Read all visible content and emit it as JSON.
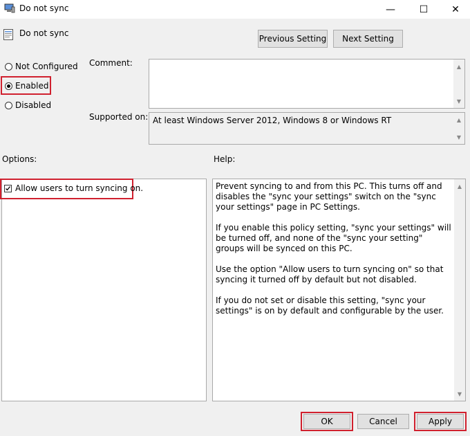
{
  "window": {
    "title": "Do not sync",
    "controls": {
      "minimize": "—",
      "maximize": "☐",
      "close": "✕"
    }
  },
  "policy": {
    "name": "Do not sync"
  },
  "nav": {
    "previous_label": "Previous Setting",
    "next_label": "Next Setting"
  },
  "state": {
    "options": [
      {
        "label": "Not Configured",
        "selected": false
      },
      {
        "label": "Enabled",
        "selected": true
      },
      {
        "label": "Disabled",
        "selected": false
      }
    ]
  },
  "comment": {
    "label": "Comment:",
    "value": ""
  },
  "supported": {
    "label": "Supported on:",
    "value": "At least Windows Server 2012, Windows 8 or Windows RT"
  },
  "options_panel": {
    "label": "Options:",
    "checkbox_label": "Allow users to turn syncing on.",
    "checked": true
  },
  "help": {
    "label": "Help:",
    "paragraphs": [
      "Prevent syncing to and from this PC.  This turns off and disables the \"sync your settings\" switch on the \"sync your settings\" page in PC Settings.",
      "If you enable this policy setting, \"sync your settings\" will be turned off, and none of the \"sync your setting\" groups will be synced on this PC.",
      "Use the option \"Allow users to turn syncing on\" so that syncing it turned off by default but not disabled.",
      "If you do not set or disable this setting, \"sync your settings\" is on by default and configurable by the user."
    ]
  },
  "footer": {
    "ok_label": "OK",
    "cancel_label": "Cancel",
    "apply_label": "Apply"
  },
  "colors": {
    "highlight": "#d0202e",
    "background": "#f0f0f0"
  }
}
